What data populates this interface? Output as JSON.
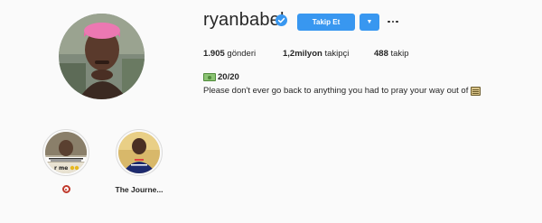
{
  "profile": {
    "username": "ryanbabel",
    "verified": true,
    "follow_label": "Takip Et",
    "dropdown_icon": "chevron-down-icon",
    "more_icon": "ellipsis-icon",
    "avatar_icon": "profile-avatar"
  },
  "stats": {
    "posts_value": "1.905",
    "posts_label": " gönderi",
    "followers_value": "1,2milyon",
    "followers_label": " takipçi",
    "following_value": "488",
    "following_label": " takip"
  },
  "bio": {
    "line1_icon": "money-icon",
    "line1_text": "20/20",
    "line2_text": "Please don't ever go back to anything you had to pray your way out of",
    "line2_icon": "book-icon"
  },
  "highlights": [
    {
      "label": "",
      "label_icon": "target-icon"
    },
    {
      "label": "The Journe..."
    }
  ],
  "colors": {
    "accent": "#3897f0",
    "background": "#fafafa",
    "text": "#262626"
  }
}
